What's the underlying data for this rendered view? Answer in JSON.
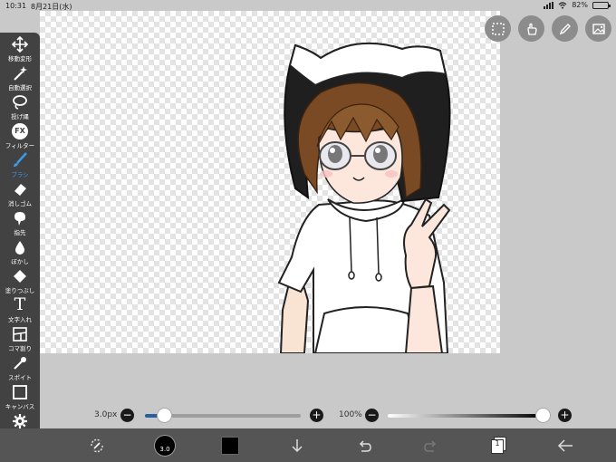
{
  "status_bar": {
    "time": "10:31",
    "date": "8月21日(水)",
    "battery": "82%",
    "battery_level": 0.82
  },
  "tools": [
    {
      "id": "move",
      "label": "移動変形",
      "icon": "move-arrows-icon"
    },
    {
      "id": "magic",
      "label": "自動選択",
      "icon": "magic-wand-icon"
    },
    {
      "id": "lasso",
      "label": "投げ縄",
      "icon": "lasso-icon"
    },
    {
      "id": "fx",
      "label": "フィルター",
      "icon": "fx-icon",
      "icon_text": "FX"
    },
    {
      "id": "brush",
      "label": "ブラシ",
      "icon": "brush-icon",
      "active": true
    },
    {
      "id": "eraser",
      "label": "消しゴム",
      "icon": "eraser-icon"
    },
    {
      "id": "smudge",
      "label": "指先",
      "icon": "smudge-icon"
    },
    {
      "id": "blur",
      "label": "ぼかし",
      "icon": "drop-icon"
    },
    {
      "id": "fill",
      "label": "塗りつぶし",
      "icon": "bucket-icon"
    },
    {
      "id": "text",
      "label": "文字入れ",
      "icon": "text-icon",
      "icon_text": "T"
    },
    {
      "id": "frame",
      "label": "コマ割り",
      "icon": "frame-icon"
    },
    {
      "id": "eyedropper",
      "label": "スポイト",
      "icon": "eyedropper-icon"
    },
    {
      "id": "canvas",
      "label": "キャンバス",
      "icon": "canvas-icon"
    },
    {
      "id": "settings",
      "label": "設定",
      "icon": "gear-icon"
    }
  ],
  "top_buttons": [
    "selection-icon",
    "hand-icon",
    "pen-icon",
    "gallery-icon"
  ],
  "brush_size": {
    "label": "3.0px",
    "level": 0.12
  },
  "opacity": {
    "label": "100%",
    "level": 1.0
  },
  "bottom_bar": {
    "brush_circle_label": "3.0",
    "color": "#000000",
    "layer_count": "1",
    "icons": [
      "transform-icon",
      "brush-size-icon",
      "color-icon",
      "download-icon",
      "undo-icon",
      "redo-icon",
      "layers-icon",
      "back-icon"
    ]
  },
  "colors": {
    "accent": "#3b9be8",
    "panel": "#424242",
    "bottom": "#555555"
  }
}
